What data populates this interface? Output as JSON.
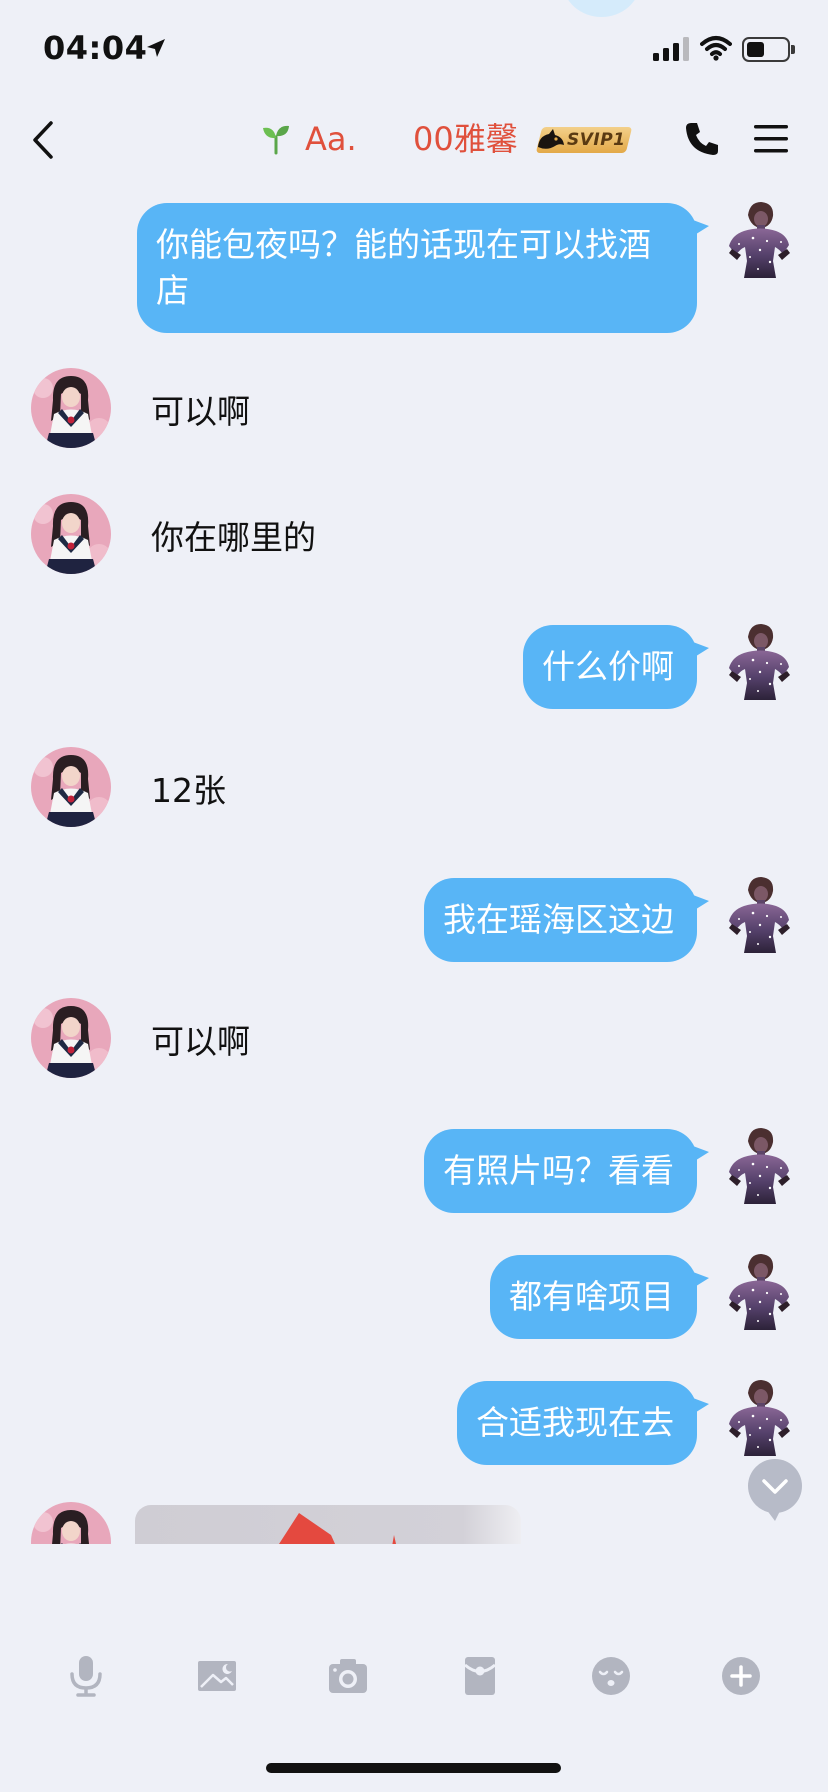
{
  "status_bar": {
    "time": "04:04",
    "signal_bars": 3,
    "signal_bars_total": 4,
    "battery_level": 0.45,
    "icons": [
      "location-arrow-icon",
      "signal-icon",
      "wifi-icon",
      "battery-icon"
    ]
  },
  "header": {
    "nickname_tag": "Aa.",
    "contact_name": "00雅馨",
    "vip_badge": "SVIP1",
    "icons": [
      "back-icon",
      "sprout-icon",
      "phone-icon",
      "menu-icon"
    ]
  },
  "messages": [
    {
      "outgoing": true,
      "text": "你能包夜吗？能的话现在可以找酒店"
    },
    {
      "outgoing": false,
      "text": "可以啊"
    },
    {
      "outgoing": false,
      "text": "你在哪里的"
    },
    {
      "outgoing": true,
      "text": "什么价啊"
    },
    {
      "outgoing": false,
      "text": "12张"
    },
    {
      "outgoing": true,
      "text": "我在瑶海区这边"
    },
    {
      "outgoing": false,
      "text": "可以啊"
    },
    {
      "outgoing": true,
      "text": "有照片吗？看看"
    },
    {
      "outgoing": true,
      "text": "都有啥项目"
    },
    {
      "outgoing": true,
      "text": "合适我现在去"
    },
    {
      "outgoing": false,
      "image": true
    }
  ],
  "scroll_button": {
    "icon": "chevron-down-icon"
  },
  "toolbar": {
    "icons": [
      "microphone-icon",
      "image-icon",
      "camera-icon",
      "red-packet-icon",
      "emoji-icon",
      "plus-icon"
    ]
  },
  "colors": {
    "background": "#eef0f7",
    "outgoing_bubble": "#58b5f6",
    "name_red": "#e0503c",
    "icon_gray": "#b2b5c0",
    "vip_gold": "#e9b95a"
  }
}
